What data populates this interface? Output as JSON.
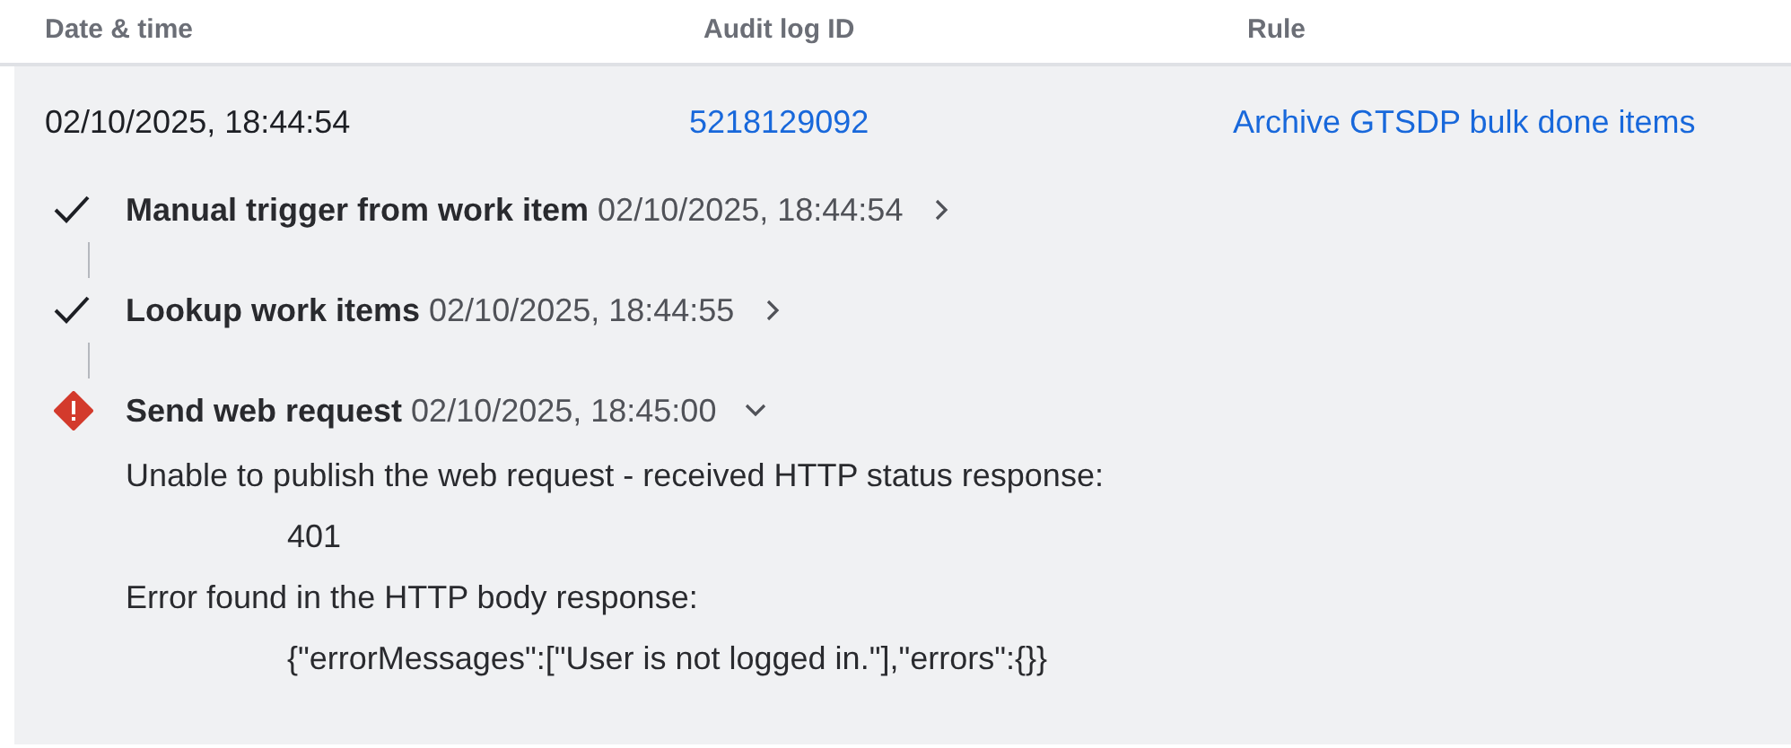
{
  "table": {
    "columns": [
      "Date & time",
      "Audit log ID",
      "Rule"
    ],
    "row": {
      "date_time": "02/10/2025, 18:44:54",
      "audit_log_id": "5218129092",
      "rule": "Archive GTSDP bulk done items"
    }
  },
  "steps": [
    {
      "kind": "success",
      "title": "Manual trigger from work item",
      "time": "02/10/2025, 18:44:54",
      "expanded": false
    },
    {
      "kind": "success",
      "title": "Lookup work items",
      "time": "02/10/2025, 18:44:55",
      "expanded": false
    },
    {
      "kind": "error",
      "title": "Send web request",
      "time": "02/10/2025, 18:45:00",
      "expanded": true,
      "details": [
        {
          "kind": "message",
          "text": "Unable to publish the web request - received HTTP status response:"
        },
        {
          "kind": "value",
          "text": "401"
        },
        {
          "kind": "message",
          "text": "Error found in the HTTP body response:"
        },
        {
          "kind": "value",
          "text": "{\"errorMessages\":[\"User is not logged in.\"],\"errors\":{}}"
        }
      ]
    }
  ]
}
